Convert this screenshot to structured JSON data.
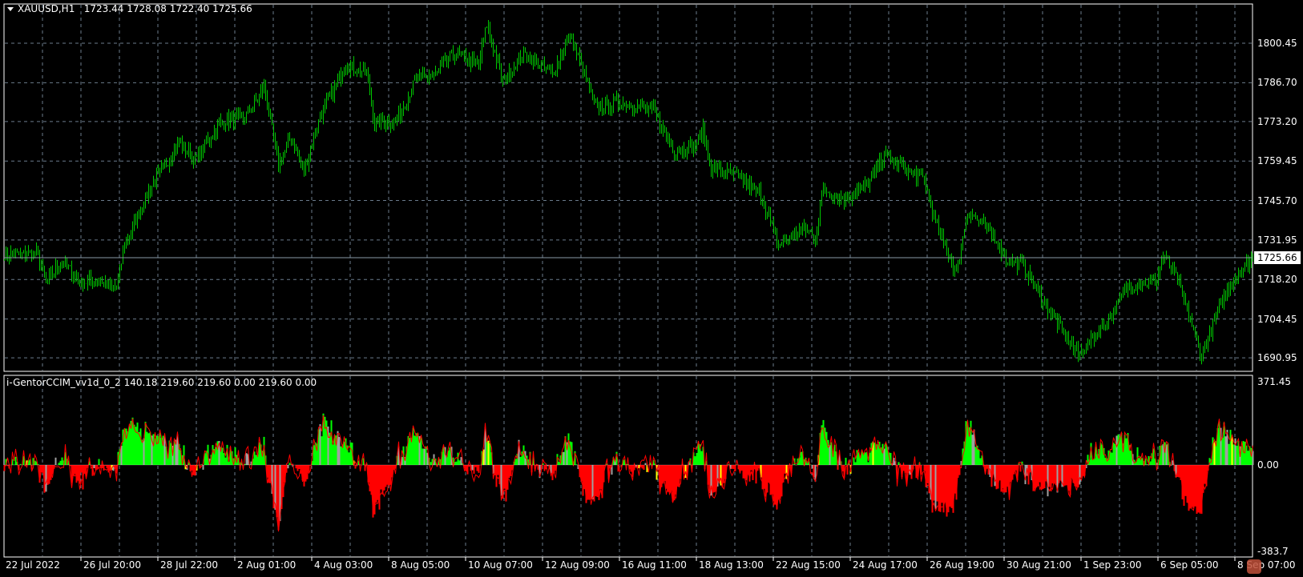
{
  "header": {
    "symbol": "XAUUSD,H1",
    "open": "1723.44",
    "high": "1728.08",
    "low": "1722.40",
    "close": "1725.66"
  },
  "indicator": {
    "name": "i-GentorCCIM_vv1d_0_2",
    "values": [
      "140.18",
      "219.60",
      "219.60",
      "0.00",
      "219.60",
      "0.00"
    ]
  },
  "price_axis": [
    "1800.45",
    "1786.70",
    "1773.20",
    "1759.45",
    "1745.70",
    "1731.95",
    "1718.20",
    "1704.45",
    "1690.95"
  ],
  "current_price": "1725.66",
  "indicator_axis": [
    "371.45",
    "0.00",
    "-383.7"
  ],
  "time_axis": [
    "22 Jul 2022",
    "26 Jul 20:00",
    "28 Jul 22:00",
    "2 Aug 01:00",
    "4 Aug 03:00",
    "8 Aug 05:00",
    "10 Aug 07:00",
    "12 Aug 09:00",
    "16 Aug 11:00",
    "18 Aug 13:00",
    "22 Aug 15:00",
    "24 Aug 17:00",
    "26 Aug 19:00",
    "30 Aug 21:00",
    "1 Sep 23:00",
    "6 Sep 05:00",
    "8 Sep 07:00"
  ],
  "colors": {
    "bars": "#00c800",
    "hist_up": "#00ff00",
    "hist_down": "#ff0000",
    "hist_neutral": "#a0a0a0",
    "hist_alt": "#ffff00",
    "line": "#ff0000",
    "grid": "#6b7b8c"
  },
  "chart_data": {
    "type": "bar",
    "title": "XAUUSD,H1",
    "ylim": [
      1686,
      1812
    ],
    "bar_count": 780,
    "price_path": [
      [
        0,
        1727
      ],
      [
        21,
        1727
      ],
      [
        26,
        1717
      ],
      [
        36,
        1725
      ],
      [
        47,
        1717
      ],
      [
        57,
        1718
      ],
      [
        70,
        1715
      ],
      [
        75,
        1730
      ],
      [
        91,
        1750
      ],
      [
        99,
        1757
      ],
      [
        109,
        1766
      ],
      [
        119,
        1760
      ],
      [
        135,
        1773
      ],
      [
        151,
        1775
      ],
      [
        162,
        1785
      ],
      [
        171,
        1758
      ],
      [
        179,
        1768
      ],
      [
        187,
        1756
      ],
      [
        197,
        1775
      ],
      [
        213,
        1793
      ],
      [
        226,
        1790
      ],
      [
        231,
        1773
      ],
      [
        244,
        1773
      ],
      [
        257,
        1788
      ],
      [
        270,
        1790
      ],
      [
        280,
        1797
      ],
      [
        296,
        1793
      ],
      [
        301,
        1807
      ],
      [
        311,
        1787
      ],
      [
        324,
        1797
      ],
      [
        342,
        1790
      ],
      [
        353,
        1803
      ],
      [
        363,
        1788
      ],
      [
        369,
        1778
      ],
      [
        384,
        1780
      ],
      [
        405,
        1777
      ],
      [
        418,
        1763
      ],
      [
        431,
        1765
      ],
      [
        436,
        1770
      ],
      [
        441,
        1757
      ],
      [
        457,
        1754
      ],
      [
        472,
        1748
      ],
      [
        483,
        1730
      ],
      [
        498,
        1736
      ],
      [
        506,
        1733
      ],
      [
        511,
        1750
      ],
      [
        524,
        1746
      ],
      [
        540,
        1752
      ],
      [
        549,
        1762
      ],
      [
        561,
        1757
      ],
      [
        574,
        1753
      ],
      [
        581,
        1738
      ],
      [
        594,
        1720
      ],
      [
        601,
        1742
      ],
      [
        618,
        1733
      ],
      [
        625,
        1725
      ],
      [
        636,
        1723
      ],
      [
        649,
        1710
      ],
      [
        670,
        1692
      ],
      [
        690,
        1705
      ],
      [
        701,
        1716
      ],
      [
        719,
        1718
      ],
      [
        723,
        1727
      ],
      [
        732,
        1718
      ],
      [
        747,
        1692
      ],
      [
        758,
        1708
      ],
      [
        766,
        1718
      ],
      [
        779,
        1726
      ]
    ],
    "indicator_ylim": [
      -383.7,
      371.45
    ]
  }
}
